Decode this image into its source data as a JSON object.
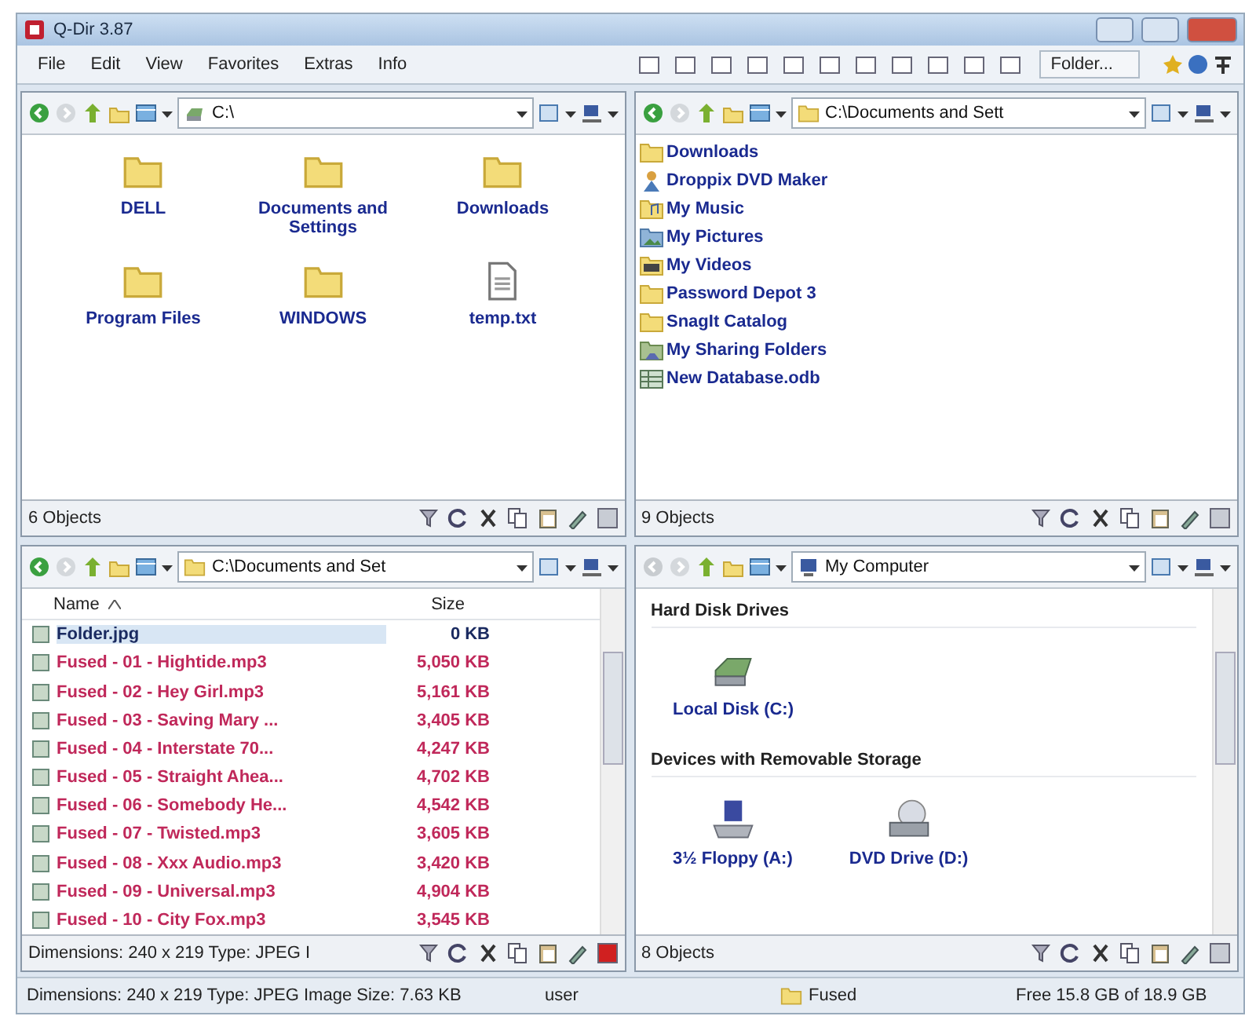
{
  "window": {
    "title": "Q-Dir 3.87"
  },
  "menu": [
    "File",
    "Edit",
    "View",
    "Favorites",
    "Extras",
    "Info"
  ],
  "toolbar": {
    "folder_button": "Folder..."
  },
  "panes": [
    {
      "kind": "icons",
      "address": "C:\\",
      "back_disabled": false,
      "active": false,
      "status": "6 Objects",
      "items": [
        {
          "kind": "folder",
          "name": "DELL"
        },
        {
          "kind": "folder",
          "name": "Documents and Settings"
        },
        {
          "kind": "folder",
          "name": "Downloads"
        },
        {
          "kind": "folder",
          "name": "Program Files"
        },
        {
          "kind": "folder",
          "name": "WINDOWS"
        },
        {
          "kind": "file",
          "name": "temp.txt"
        }
      ]
    },
    {
      "kind": "list",
      "address": "C:\\Documents and Sett",
      "back_disabled": false,
      "active": false,
      "status": "9 Objects",
      "items": [
        {
          "kind": "folder",
          "name": "Downloads"
        },
        {
          "kind": "app",
          "name": "Droppix DVD Maker"
        },
        {
          "kind": "music",
          "name": "My Music"
        },
        {
          "kind": "pictures",
          "name": "My Pictures"
        },
        {
          "kind": "videos",
          "name": "My Videos"
        },
        {
          "kind": "folder",
          "name": "Password Depot 3"
        },
        {
          "kind": "folder",
          "name": "SnagIt Catalog"
        },
        {
          "kind": "share",
          "name": "My Sharing Folders"
        },
        {
          "kind": "database",
          "name": "New Database.odb"
        }
      ]
    },
    {
      "kind": "details",
      "address": "C:\\Documents and Set",
      "back_disabled": false,
      "active": true,
      "status": "Dimensions: 240 x 219 Type: JPEG I",
      "columns": [
        "Name",
        "Size"
      ],
      "rows": [
        {
          "name": "Folder.jpg",
          "size": "0 KB",
          "selected": true,
          "color": "#1a2a60"
        },
        {
          "name": "Fused - 01 - Hightide.mp3",
          "size": "5,050 KB",
          "selected": false,
          "color": "#c0285a"
        },
        {
          "name": "Fused - 02 - Hey Girl.mp3",
          "size": "5,161 KB",
          "selected": false,
          "color": "#c0285a"
        },
        {
          "name": "Fused - 03 - Saving Mary ...",
          "size": "3,405 KB",
          "selected": false,
          "color": "#c0285a"
        },
        {
          "name": "Fused - 04 - Interstate 70...",
          "size": "4,247 KB",
          "selected": false,
          "color": "#c0285a"
        },
        {
          "name": "Fused - 05 - Straight Ahea...",
          "size": "4,702 KB",
          "selected": false,
          "color": "#c0285a"
        },
        {
          "name": "Fused - 06 - Somebody He...",
          "size": "4,542 KB",
          "selected": false,
          "color": "#c0285a"
        },
        {
          "name": "Fused - 07 - Twisted.mp3",
          "size": "3,605 KB",
          "selected": false,
          "color": "#c0285a"
        },
        {
          "name": "Fused - 08 - Xxx Audio.mp3",
          "size": "3,420 KB",
          "selected": false,
          "color": "#c0285a"
        },
        {
          "name": "Fused - 09 - Universal.mp3",
          "size": "4,904 KB",
          "selected": false,
          "color": "#c0285a"
        },
        {
          "name": "Fused - 10 - City Fox.mp3",
          "size": "3,545 KB",
          "selected": false,
          "color": "#c0285a"
        }
      ]
    },
    {
      "kind": "groups",
      "address": "My Computer",
      "back_disabled": true,
      "active": false,
      "status": "8 Objects",
      "groups": [
        {
          "title": "Hard Disk Drives",
          "items": [
            {
              "kind": "disk",
              "name": "Local Disk (C:)"
            }
          ]
        },
        {
          "title": "Devices with Removable Storage",
          "items": [
            {
              "kind": "floppy",
              "name": "3½ Floppy (A:)"
            },
            {
              "kind": "dvd",
              "name": "DVD Drive (D:)"
            }
          ]
        }
      ]
    }
  ],
  "status_bar": {
    "info": "Dimensions: 240 x 219 Type: JPEG Image Size: 7.63 KB",
    "user": "user",
    "folder": "Fused",
    "free": "Free 15.8 GB of 18.9 GB"
  }
}
